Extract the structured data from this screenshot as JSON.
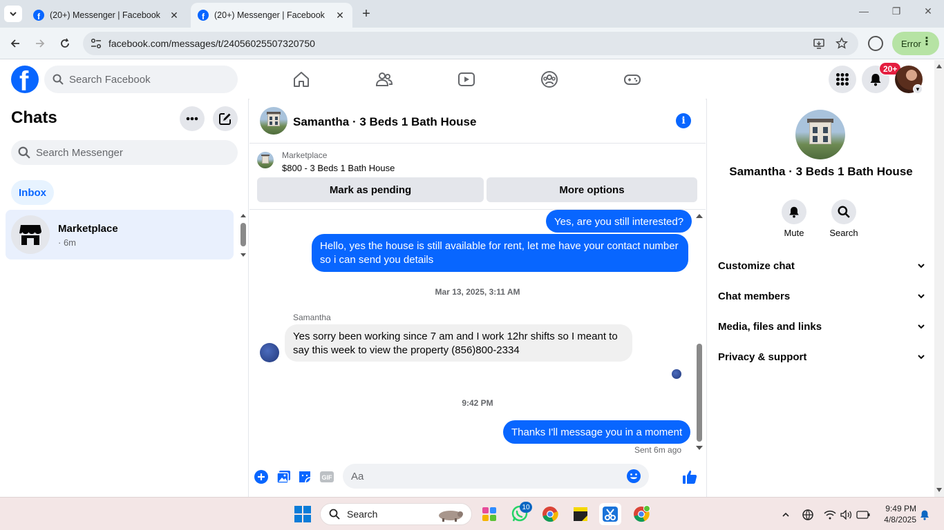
{
  "browser": {
    "tabs": [
      {
        "title": "(20+) Messenger | Facebook",
        "active": false
      },
      {
        "title": "(20+) Messenger | Facebook",
        "active": true
      }
    ],
    "url": "facebook.com/messages/t/24056025507320750",
    "error_label": "Error"
  },
  "fb_header": {
    "search_placeholder": "Search Facebook",
    "notification_count": "20+",
    "nav_icons": [
      "home-icon",
      "friends-icon",
      "video-icon",
      "groups-icon",
      "gaming-icon"
    ]
  },
  "chats": {
    "title": "Chats",
    "search_placeholder": "Search Messenger",
    "filter_label": "Inbox",
    "items": [
      {
        "name": "Marketplace",
        "sub": "· 6m"
      }
    ]
  },
  "conversation": {
    "title": "Samantha · 3 Beds 1 Bath House",
    "marketplace_label": "Marketplace",
    "listing_title": "$800 - 3 Beds 1 Bath House",
    "mark_pending_label": "Mark as pending",
    "more_options_label": "More options",
    "messages": [
      {
        "from": "me",
        "text": "Yes, are you still interested?"
      },
      {
        "from": "me",
        "text": "Hello, yes the house is still available for rent, let me have your contact number so i can send you  details"
      },
      {
        "type": "timestamp",
        "text": "Mar 13, 2025, 3:11 AM"
      },
      {
        "from": "Samantha",
        "sender_label": "Samantha",
        "text": "Yes sorry been working since 7 am and I work 12hr shifts so I meant to say this week to view the property (856)800-2334"
      },
      {
        "type": "timestamp",
        "text": "9:42 PM"
      },
      {
        "from": "me",
        "text": "Thanks I'll message you in a moment"
      }
    ],
    "sent_status": "Sent 6m ago",
    "composer_placeholder": "Aa"
  },
  "right_panel": {
    "title": "Samantha · 3 Beds 1 Bath House",
    "actions": [
      {
        "label": "Mute",
        "icon": "bell-icon"
      },
      {
        "label": "Search",
        "icon": "search-icon"
      }
    ],
    "sections": [
      {
        "label": "Customize chat"
      },
      {
        "label": "Chat members"
      },
      {
        "label": "Media, files and links"
      },
      {
        "label": "Privacy & support"
      }
    ]
  },
  "taskbar": {
    "search_placeholder": "Search",
    "whatsapp_badge": "10",
    "time": "9:49 PM",
    "date": "4/8/2025"
  },
  "colors": {
    "fb_blue": "#0866ff",
    "bubble_out": "#0866ff",
    "bubble_in": "#f0f0f0",
    "notif_red": "#e41e3f",
    "error_pill": "#b6e3a4"
  }
}
